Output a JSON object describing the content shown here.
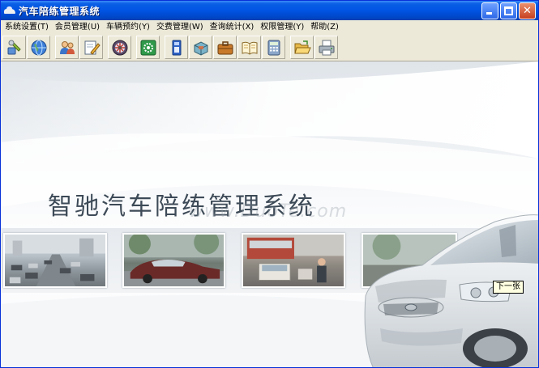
{
  "window": {
    "title": "汽车陪练管理系统",
    "buttons": [
      "minimize",
      "maximize",
      "close"
    ]
  },
  "menu": [
    {
      "label": "系统设置(T)"
    },
    {
      "label": "会员管理(U)"
    },
    {
      "label": "车辆预约(Y)"
    },
    {
      "label": "交费管理(W)"
    },
    {
      "label": "查询统计(X)"
    },
    {
      "label": "权限管理(Y)"
    },
    {
      "label": "帮助(Z)"
    }
  ],
  "toolbar": [
    {
      "icon": "tools-icon"
    },
    {
      "icon": "globe-icon"
    },
    {
      "icon": "users-icon"
    },
    {
      "icon": "edit-icon"
    },
    {
      "icon": "wheel-icon"
    },
    {
      "icon": "settings-icon"
    },
    {
      "icon": "document-icon"
    },
    {
      "icon": "box-icon"
    },
    {
      "icon": "briefcase-icon"
    },
    {
      "icon": "book-icon"
    },
    {
      "icon": "calculator-icon"
    },
    {
      "icon": "folder-open-icon"
    },
    {
      "icon": "printer-icon"
    }
  ],
  "banner": {
    "title": "智驰汽车陪练管理系统",
    "watermark": "www.DuoTe.com"
  },
  "tooltip": {
    "text": "下一张"
  },
  "colors": {
    "titlebar": "#0054e3",
    "chrome": "#ece9d8",
    "banner_text": "#3d4a57"
  }
}
